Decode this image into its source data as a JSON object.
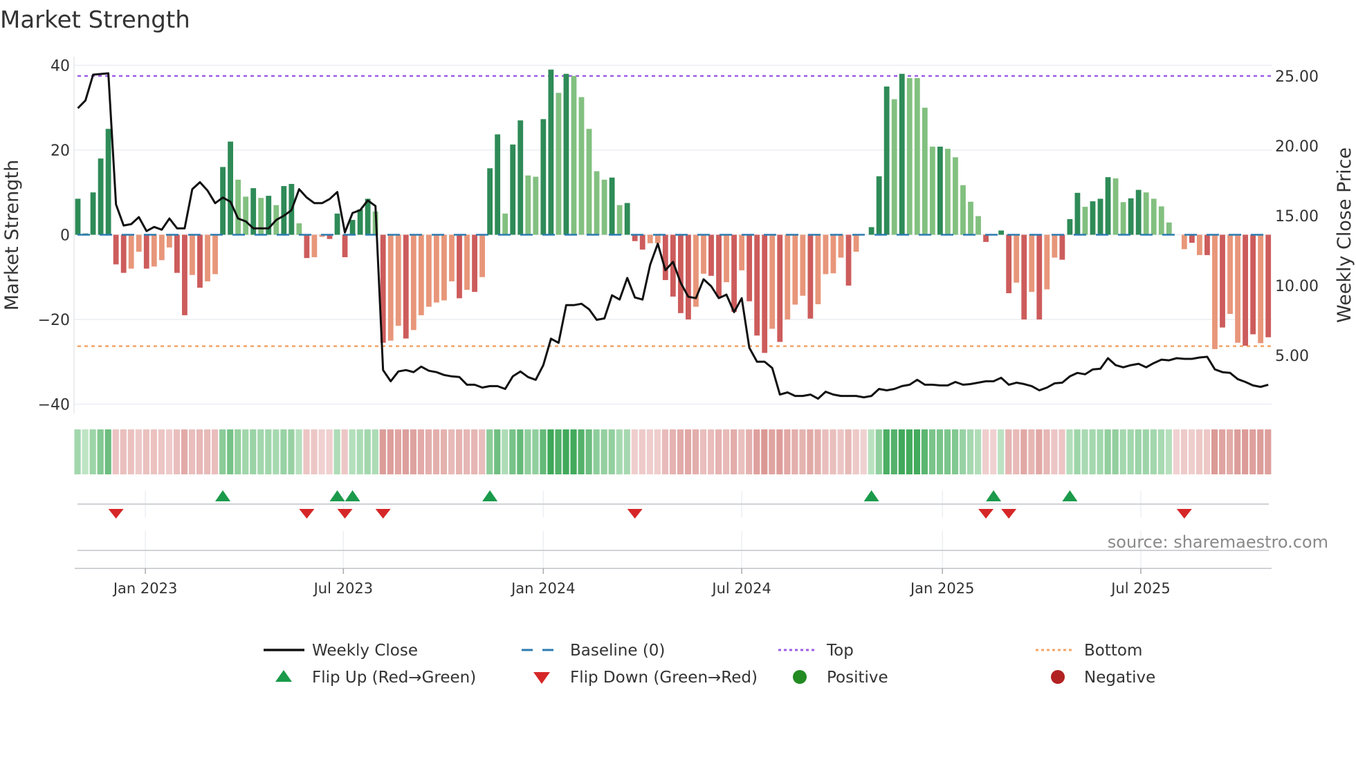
{
  "chart_data": {
    "type": "bar",
    "title": "Market Strength",
    "ylabel": "Market Strength",
    "y2label": "Weekly Close Price",
    "ylim": [
      -42,
      42
    ],
    "yticks": [
      40,
      20,
      0,
      -20,
      -40
    ],
    "ytick_labels": [
      "40",
      "20",
      "0",
      "−20",
      "−40"
    ],
    "y2ticks": [
      25,
      20,
      15,
      10,
      5
    ],
    "y2tick_labels": [
      "25.00",
      "20.00",
      "15.00",
      "10.00",
      "5.00"
    ],
    "top_level": 37.5,
    "bottom_level": -26.3,
    "baseline": 0,
    "xticks": [
      {
        "week": 8.85,
        "label": "Jan 2023"
      },
      {
        "week": 34.8,
        "label": "Jul 2023"
      },
      {
        "week": 61,
        "label": "Jan 2024"
      },
      {
        "week": 87,
        "label": "Jul 2024"
      },
      {
        "week": 113.3,
        "label": "Jan 2025"
      },
      {
        "week": 139.3,
        "label": "Jul 2025"
      }
    ],
    "strength": [
      8.5,
      0.3,
      10,
      18,
      25,
      -7,
      -9,
      -8,
      -4,
      -8,
      -7.5,
      -6,
      -3,
      -9,
      -19,
      -9.5,
      -12.5,
      -11,
      -9.3,
      16,
      22,
      13,
      9,
      11,
      8.7,
      9.2,
      7,
      11.5,
      12,
      2.7,
      -5.5,
      -5.3,
      -0.5,
      -1,
      5,
      -5.3,
      3.5,
      6,
      8.5,
      5.5,
      -25.5,
      -25,
      -21.5,
      -24.5,
      -22.5,
      -19,
      -17,
      -16,
      -15.5,
      -11,
      -15,
      -13,
      -13.5,
      -10,
      15.7,
      23.7,
      5,
      21.3,
      27,
      14,
      13.7,
      27.3,
      39,
      33.5,
      38,
      37.5,
      32.5,
      25,
      15,
      13,
      13.5,
      7,
      7.5,
      -1.5,
      -3.5,
      -2,
      -2,
      -10.7,
      -14.6,
      -18.5,
      -20,
      -17,
      -9.2,
      -9.7,
      -14.6,
      -11.2,
      -18.2,
      -8.4,
      -15.7,
      -23.8,
      -27.9,
      -22.2,
      -25.3,
      -20,
      -16.5,
      -14.4,
      -19.8,
      -16.4,
      -9.3,
      -9.1,
      -5.4,
      -12,
      -4,
      0,
      1.8,
      13.8,
      35,
      32,
      38,
      37,
      37,
      30,
      20.8,
      20.8,
      20.3,
      18.3,
      11.7,
      7.8,
      4.4,
      -1.7,
      0,
      1,
      -13.8,
      -11.3,
      -20,
      -13.5,
      -20,
      -12.9,
      -5.4,
      -5.9,
      3.7,
      9.9,
      6.6,
      7.9,
      8.5,
      13.6,
      13.3,
      7.7,
      8.6,
      10.6,
      10,
      8.5,
      6.7,
      2.9,
      0,
      -3.4,
      -1.9,
      -4.8,
      -4.8,
      -27,
      -21.9,
      -18.7,
      -25.5,
      -26.2,
      -23.5,
      -25.6,
      -24.2
    ],
    "shade": "dddddddlldlllddldllddlldldlddldlldddddd",
    "shade2": "ldlldlllllldldl",
    "shade3": "ddlddllddldllllldldddllddddllddldldddldllldlllldlldddldlllldlll",
    "shade4": "lldlddldldlldddldddllddlllllldldldllddldl",
    "weekly_close": [
      22.7,
      23.25,
      25.1,
      25.15,
      25.2,
      15.8,
      14.3,
      14.4,
      14.9,
      13.9,
      14.2,
      14.0,
      14.8,
      14.1,
      14.1,
      16.9,
      17.4,
      16.8,
      15.9,
      16.3,
      16.0,
      14.8,
      14.6,
      14.1,
      14.1,
      14.1,
      14.7,
      15.0,
      15.4,
      16.9,
      16.3,
      15.9,
      15.9,
      16.2,
      16.7,
      13.8,
      15.2,
      15.4,
      16.1,
      15.7,
      3.95,
      3.15,
      3.85,
      3.95,
      3.8,
      4.2,
      3.9,
      3.8,
      3.6,
      3.5,
      3.45,
      2.9,
      2.9,
      2.7,
      2.8,
      2.8,
      2.6,
      3.5,
      3.85,
      3.45,
      3.25,
      4.3,
      6.2,
      5.9,
      8.6,
      8.6,
      8.7,
      8.3,
      7.55,
      7.65,
      9.3,
      9.0,
      10.55,
      9.15,
      9.0,
      11.5,
      13.0,
      11.1,
      11.7,
      10.2,
      9.2,
      9.1,
      10.45,
      9.95,
      9.1,
      9.35,
      8.1,
      9.1,
      5.55,
      4.55,
      4.55,
      4.1,
      2.2,
      2.35,
      2.1,
      2.1,
      2.2,
      1.9,
      2.4,
      2.2,
      2.1,
      2.1,
      2.1,
      2.0,
      2.1,
      2.6,
      2.5,
      2.6,
      2.8,
      2.9,
      3.25,
      2.9,
      2.9,
      2.85,
      2.85,
      3.1,
      2.9,
      2.95,
      3.05,
      3.15,
      3.15,
      3.4,
      2.9,
      3.05,
      2.95,
      2.8,
      2.5,
      2.7,
      3.0,
      3.05,
      3.5,
      3.75,
      3.65,
      4.0,
      4.05,
      4.8,
      4.3,
      4.15,
      4.3,
      4.4,
      4.15,
      4.45,
      4.7,
      4.65,
      4.8,
      4.75,
      4.75,
      4.85,
      4.9,
      4.0,
      3.8,
      3.75,
      3.3,
      3.1,
      2.85,
      2.75,
      2.9
    ],
    "flip_up_weeks": [
      19,
      34,
      36,
      54,
      104,
      120,
      130
    ],
    "flip_down_weeks": [
      5,
      30,
      35,
      40,
      73,
      119,
      122,
      145
    ],
    "legend": [
      {
        "label": "Weekly Close",
        "symbol": "line"
      },
      {
        "label": "Baseline (0)",
        "symbol": "dash"
      },
      {
        "label": "Top",
        "symbol": "dot-purple"
      },
      {
        "label": "Bottom",
        "symbol": "dot-orange"
      },
      {
        "label": "Flip Up (Red→Green)",
        "symbol": "triangle-up"
      },
      {
        "label": "Flip Down (Green→Red)",
        "symbol": "triangle-down"
      },
      {
        "label": "Positive",
        "symbol": "circle-green"
      },
      {
        "label": "Negative",
        "symbol": "circle-red"
      }
    ],
    "legend_position": "bottom",
    "source": "source: sharemaestro.com"
  },
  "colors": {
    "pos_dark": "#2e8b57",
    "pos_light": "#82c080",
    "neg_dark": "#cd5c5c",
    "neg_light": "#e8967a",
    "line": "#111111",
    "baseline": "#2b7bb0",
    "top": "#9d5ce6",
    "bottom": "#f3a467",
    "flip_up": "#1a9a4a",
    "flip_down": "#d62728",
    "positive": "#228b22",
    "negative": "#b22222"
  }
}
